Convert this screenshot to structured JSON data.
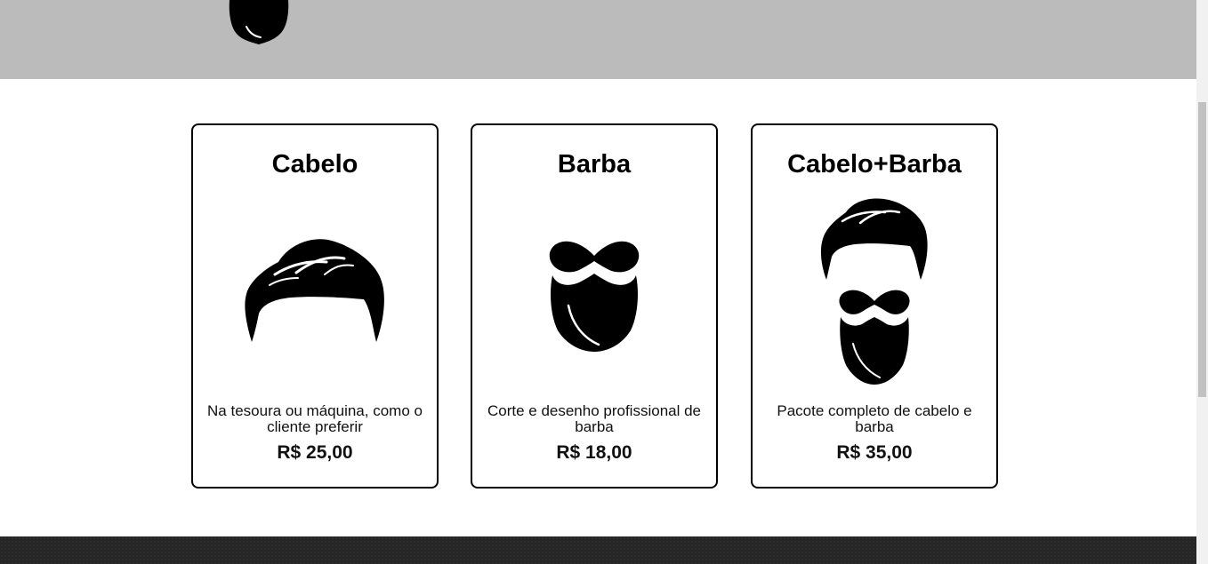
{
  "services": [
    {
      "title": "Cabelo",
      "icon": "hair-icon",
      "description": "Na tesoura ou máquina, como o cliente preferir",
      "price": "R$ 25,00"
    },
    {
      "title": "Barba",
      "icon": "beard-icon",
      "description": "Corte e desenho profissional de barba",
      "price": "R$ 18,00"
    },
    {
      "title": "Cabelo+Barba",
      "icon": "hair-and-beard-icon",
      "description": "Pacote completo de cabelo e barba",
      "price": "R$ 35,00"
    }
  ],
  "colors": {
    "header_bg": "#bbbbbb",
    "footer_bg": "#262626",
    "card_border": "#000000"
  }
}
